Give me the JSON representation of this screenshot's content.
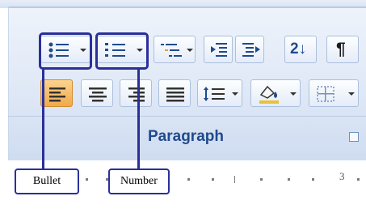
{
  "ribbon": {
    "group_label": "Paragraph",
    "launcher_icon": "dialog-launcher-icon",
    "row1_buttons": [
      "bullets-icon",
      "numbering-icon",
      "multilevel-list-icon",
      "decrease-indent-icon",
      "increase-indent-icon",
      "sort-icon",
      "show-formatting-marks-icon"
    ],
    "row2_buttons": [
      "align-left-icon",
      "center-icon",
      "align-right-icon",
      "justify-icon",
      "line-spacing-icon",
      "shading-icon",
      "borders-icon"
    ],
    "sort_glyph": "2↓",
    "pilcrow_glyph": "¶"
  },
  "callouts": {
    "bullet_label": "Bullet",
    "number_label": "Number",
    "color": "#2a2f9a"
  },
  "ruler": {
    "numbers": [
      "1",
      "3"
    ]
  },
  "colors": {
    "label": "#1f4a8c",
    "highlight_orange": "#e89a3c"
  }
}
